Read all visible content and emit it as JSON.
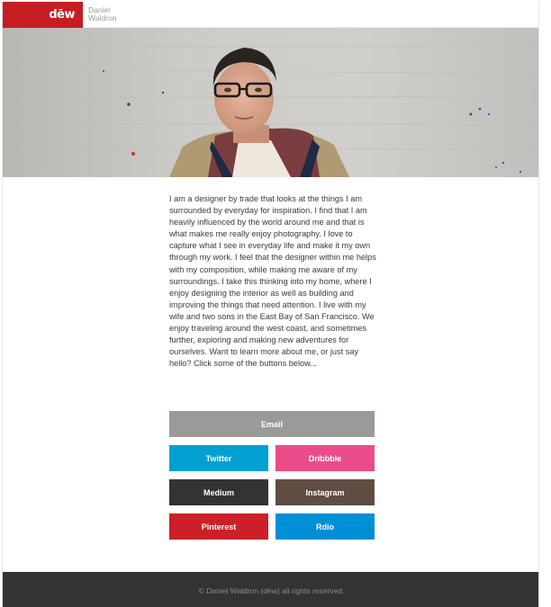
{
  "header": {
    "logo_text": "dēw",
    "name_first": "Daniel",
    "name_last": "Waldron",
    "brand_color": "#c61d23"
  },
  "bio": {
    "text": "I am a designer by trade that looks at the things I am surrounded by everyday for inspiration. I find that I am heavily influenced by the world around me and that is what makes me really enjoy photography. I love to capture what I see in everyday life and make it my own through my work. I feel that the designer within me helps with my composition, while making me aware of my surroundings. I take this thinking into my home, where I enjoy designing the interior as well as building and improving the things that need attention. I live with my wife and two sons in the East Bay of San Francisco. We enjoy traveling around the west coast, and sometimes further, exploring and making new adventures for ourselves. Want to learn more about me, or just say hello? Click some of the buttons below..."
  },
  "buttons": {
    "email": "Email",
    "twitter": "Twitter",
    "dribbble": "Dribbble",
    "medium": "Medium",
    "instagram": "Instagram",
    "pinterest": "Pinterest",
    "rdio": "Rdio"
  },
  "colors": {
    "email": "#9b9a98",
    "twitter": "#00a0d1",
    "dribbble": "#ea4c89",
    "medium": "#333332",
    "instagram": "#5f4d41",
    "pinterest": "#cb2027",
    "rdio": "#008fd5",
    "footer": "#333333"
  },
  "footer": {
    "text": "© Daniel Waldron (dēw) all rights reserved."
  }
}
